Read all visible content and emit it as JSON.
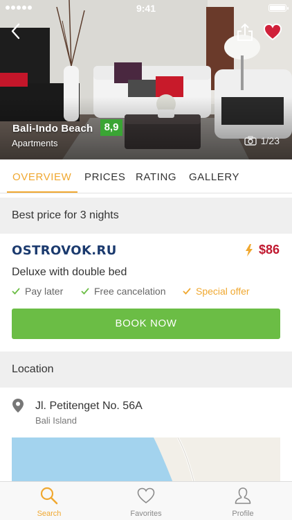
{
  "status_bar": {
    "time": "9:41"
  },
  "hotel": {
    "name": "Bali-Indo Beach",
    "score": "8,9",
    "type": "Apartments",
    "photo_counter": "1/23"
  },
  "tabs": [
    {
      "label": "OVERVIEW",
      "active": true
    },
    {
      "label": "PRICES",
      "active": false
    },
    {
      "label": "RATING",
      "active": false
    },
    {
      "label": "GALLERY",
      "active": false
    }
  ],
  "best_price": {
    "header": "Best price for 3 nights",
    "provider": "OSTROVOK.RU",
    "price": "$86",
    "room": "Deluxe with double bed",
    "features": [
      {
        "label": "Pay later",
        "style": "plain"
      },
      {
        "label": "Free cancelation",
        "style": "plain"
      },
      {
        "label": "Special offer",
        "style": "special"
      }
    ],
    "book_label": "BOOK NOW"
  },
  "location": {
    "header": "Location",
    "address": "Jl. Petitenget No. 56A",
    "city": "Bali Island"
  },
  "tabbar": [
    {
      "label": "Search",
      "icon": "search-icon",
      "active": true
    },
    {
      "label": "Favorites",
      "icon": "heart-outline-icon",
      "active": false
    },
    {
      "label": "Profile",
      "icon": "user-icon",
      "active": false
    }
  ],
  "colors": {
    "accent": "#f0a830",
    "score_badge": "#3aa534",
    "book_button": "#6bbd45",
    "price": "#c0182f",
    "favorite": "#d0213a"
  }
}
